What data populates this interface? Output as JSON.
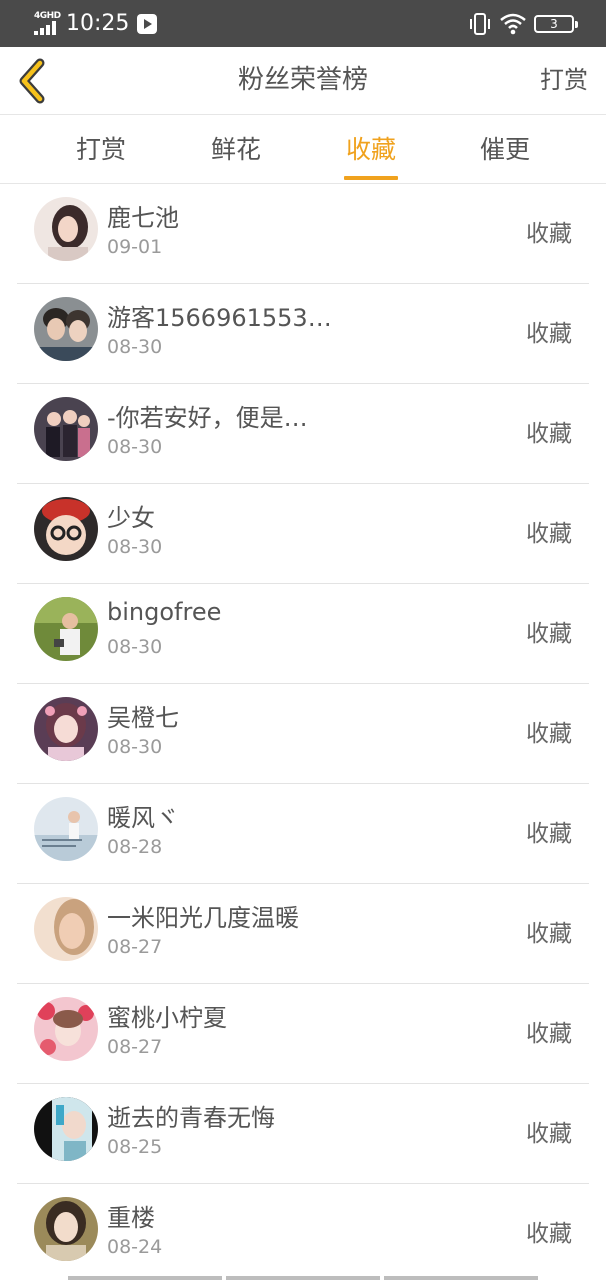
{
  "status_bar": {
    "network": "4GHD",
    "time": "10:25",
    "battery": "3"
  },
  "header": {
    "title": "粉丝荣誉榜",
    "action_label": "打赏"
  },
  "tabs": [
    {
      "label": "打赏",
      "active": false
    },
    {
      "label": "鲜花",
      "active": false
    },
    {
      "label": "收藏",
      "active": true
    },
    {
      "label": "催更",
      "active": false
    }
  ],
  "accent_color": "#f0a21e",
  "list": [
    {
      "name": "鹿七池",
      "date": "09-01",
      "action": "收藏"
    },
    {
      "name": "游客1566961553…",
      "date": "08-30",
      "action": "收藏"
    },
    {
      "name": "-你若安好，便是…",
      "date": "08-30",
      "action": "收藏"
    },
    {
      "name": "少女",
      "date": "08-30",
      "action": "收藏"
    },
    {
      "name": "bingofree",
      "date": "08-30",
      "action": "收藏"
    },
    {
      "name": "吴橙七",
      "date": "08-30",
      "action": "收藏"
    },
    {
      "name": "暖风ヾ",
      "date": "08-28",
      "action": "收藏"
    },
    {
      "name": "一米阳光几度温暖",
      "date": "08-27",
      "action": "收藏"
    },
    {
      "name": "蜜桃小柠夏",
      "date": "08-27",
      "action": "收藏"
    },
    {
      "name": "逝去的青春无悔",
      "date": "08-25",
      "action": "收藏"
    },
    {
      "name": "重楼",
      "date": "08-24",
      "action": "收藏"
    }
  ]
}
